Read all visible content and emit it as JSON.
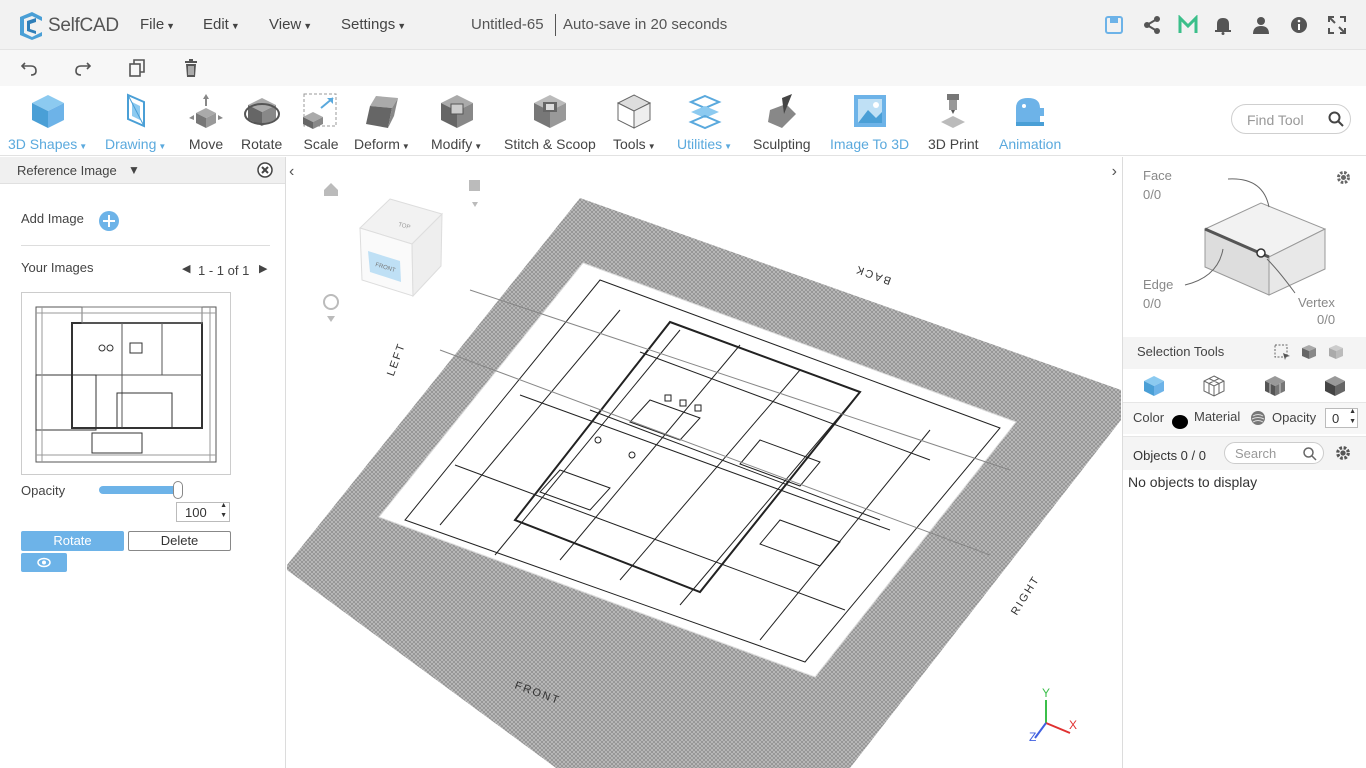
{
  "app": {
    "logo_text": "SelfCAD",
    "doc_title": "Untitled-65",
    "autosave": "Auto-save in 20 seconds"
  },
  "menus": [
    {
      "label": "File"
    },
    {
      "label": "Edit"
    },
    {
      "label": "View"
    },
    {
      "label": "Settings"
    }
  ],
  "toolbar": {
    "tools": [
      {
        "label": "3D Shapes",
        "dropdown": true,
        "blue": true
      },
      {
        "label": "Drawing",
        "dropdown": true,
        "blue": true
      },
      {
        "label": "Move",
        "dropdown": false,
        "blue": false
      },
      {
        "label": "Rotate",
        "dropdown": false,
        "blue": false
      },
      {
        "label": "Scale",
        "dropdown": false,
        "blue": false
      },
      {
        "label": "Deform",
        "dropdown": true,
        "blue": false
      },
      {
        "label": "Modify",
        "dropdown": true,
        "blue": false
      },
      {
        "label": "Stitch & Scoop",
        "dropdown": false,
        "blue": false
      },
      {
        "label": "Tools",
        "dropdown": true,
        "blue": false
      },
      {
        "label": "Utilities",
        "dropdown": true,
        "blue": true
      },
      {
        "label": "Sculpting",
        "dropdown": false,
        "blue": false
      },
      {
        "label": "Image To 3D",
        "dropdown": false,
        "blue": true
      },
      {
        "label": "3D Print",
        "dropdown": false,
        "blue": false
      },
      {
        "label": "Animation",
        "dropdown": false,
        "blue": true
      }
    ],
    "find_placeholder": "Find Tool"
  },
  "left_panel": {
    "title": "Reference Image",
    "add_image": "Add Image",
    "your_images": "Your Images",
    "pagination": "1 - 1 of 1",
    "opacity_label": "Opacity",
    "opacity_value": "100",
    "opacity_fraction": 1.0,
    "rotate_label": "Rotate",
    "delete_label": "Delete"
  },
  "viewport": {
    "cube_top": "TOP",
    "cube_front": "FRONT",
    "labels": {
      "back": "BACK",
      "left": "LEFT",
      "right": "RIGHT",
      "front": "FRONT"
    },
    "axes": {
      "x": "X",
      "y": "Y",
      "z": "Z"
    }
  },
  "right_panel": {
    "face_label": "Face",
    "face_value": "0/0",
    "edge_label": "Edge",
    "edge_value": "0/0",
    "vertex_label": "Vertex",
    "vertex_value": "0/0",
    "selection_tools": "Selection Tools",
    "color_label": "Color",
    "material_label": "Material",
    "opacity_label": "Opacity",
    "opacity_value": "0",
    "objects_label": "Objects 0 / 0",
    "search_placeholder": "Search",
    "empty_text": "No objects to display"
  },
  "colors": {
    "accent": "#5aa9dd",
    "button_blue": "#6db3e8",
    "toolbar_bg": "#f2f2f2"
  }
}
